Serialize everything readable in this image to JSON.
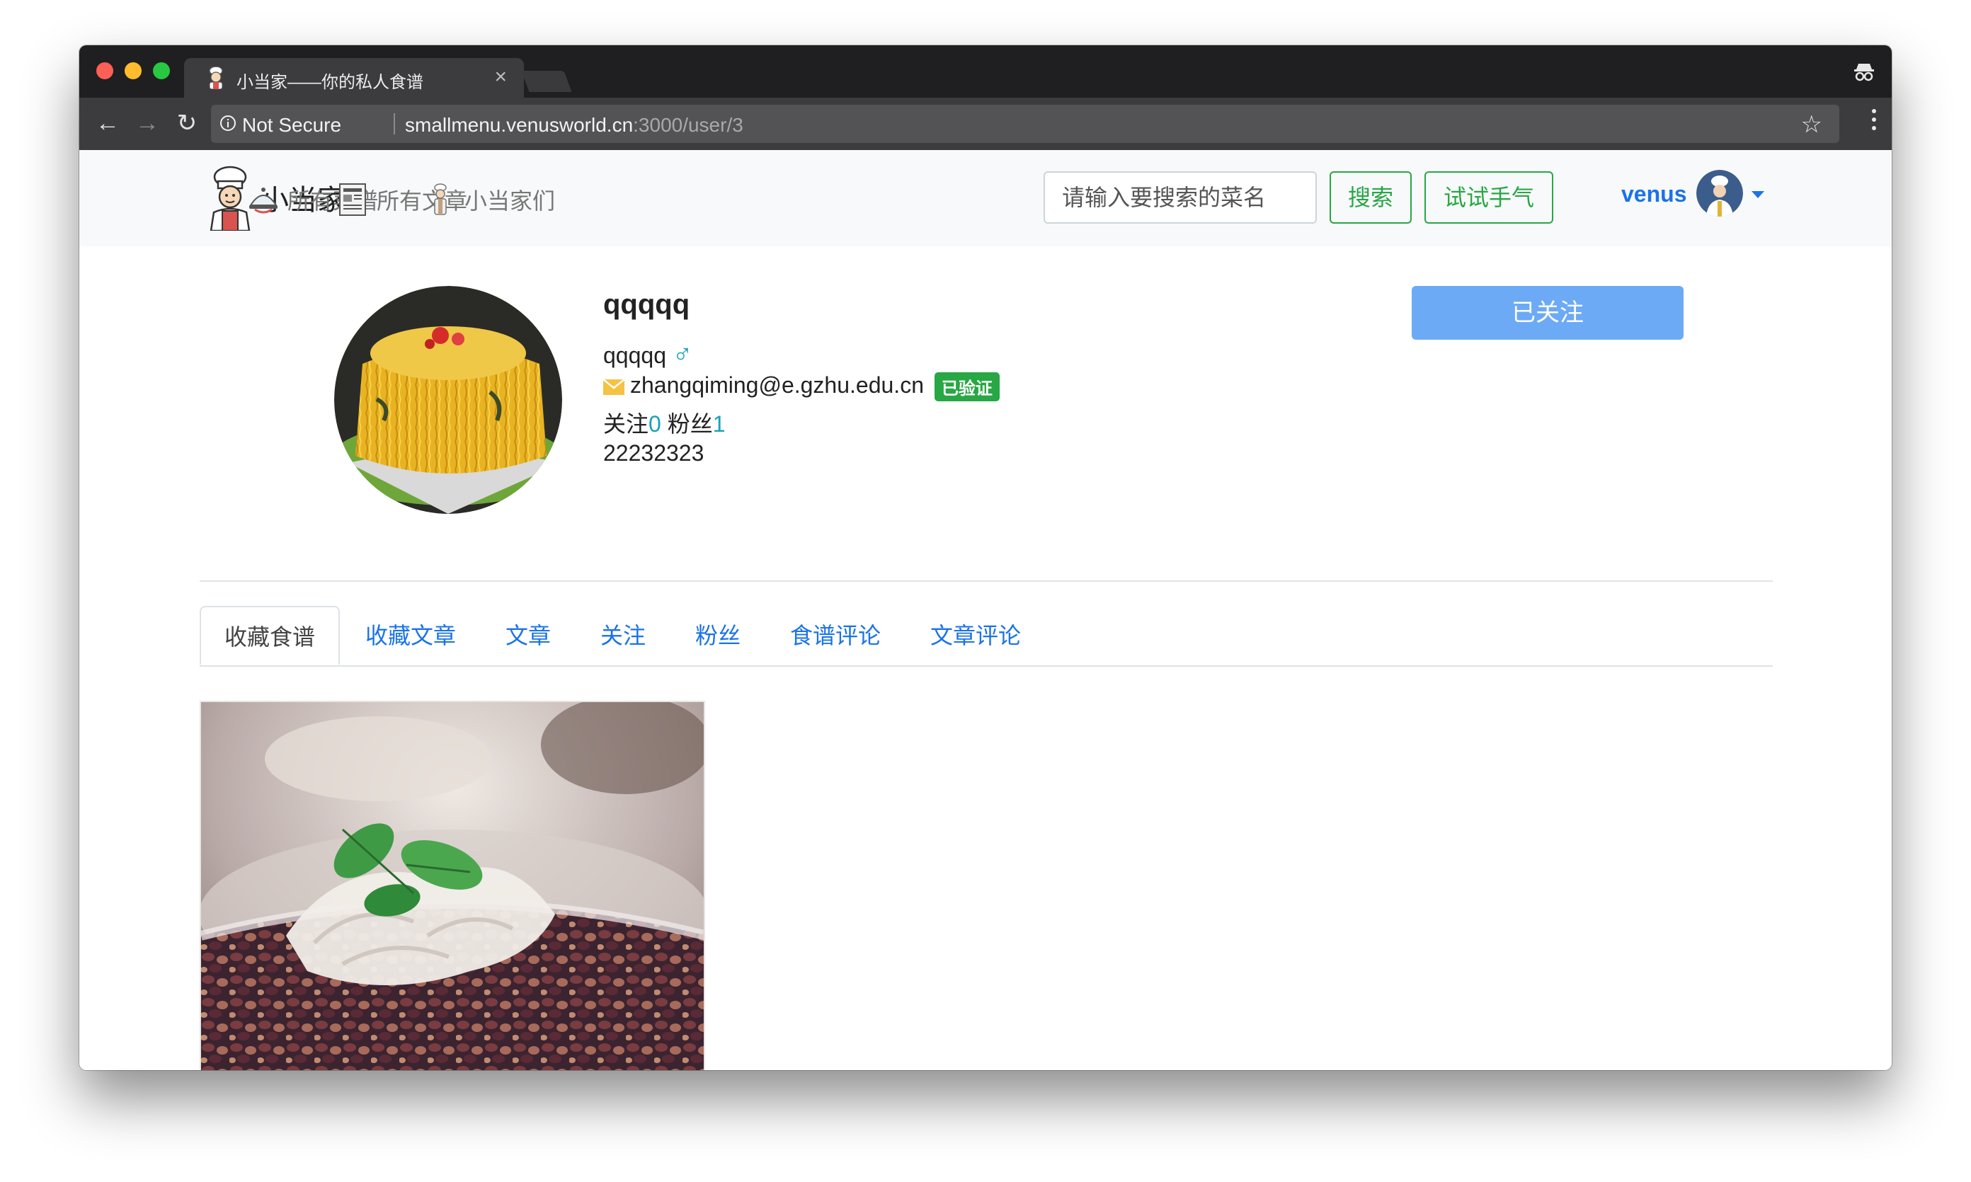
{
  "browser": {
    "tab_title": "小当家——你的私人食谱",
    "tab_close": "×",
    "not_secure": "Not Secure",
    "url_host": "smallmenu.venusworld.cn",
    "url_path": ":3000/user/3"
  },
  "navbar": {
    "brand": "小当家",
    "links": [
      "所有菜谱",
      "所有文章",
      "小当家们"
    ],
    "search_placeholder": "请输入要搜索的菜名",
    "search_button": "搜索",
    "lucky_button": "试试手气",
    "user_name": "venus"
  },
  "profile": {
    "name": "qqqqq",
    "username": "qqqqq",
    "gender_symbol": "♂",
    "email": "zhangqiming@e.gzhu.edu.cn",
    "verified_badge": "已验证",
    "following_label": "关注",
    "following_count": "0",
    "followers_label": "粉丝",
    "followers_count": "1",
    "bio": "22232323",
    "follow_button": "已关注"
  },
  "tabs": [
    "收藏食谱",
    "收藏文章",
    "文章",
    "关注",
    "粉丝",
    "食谱评论",
    "文章评论"
  ],
  "active_tab": "收藏食谱",
  "colors": {
    "accent_blue": "#1a73e8",
    "success_green": "#28a745",
    "info_teal": "#17a2b8",
    "follow_button": "#6caaf6"
  }
}
